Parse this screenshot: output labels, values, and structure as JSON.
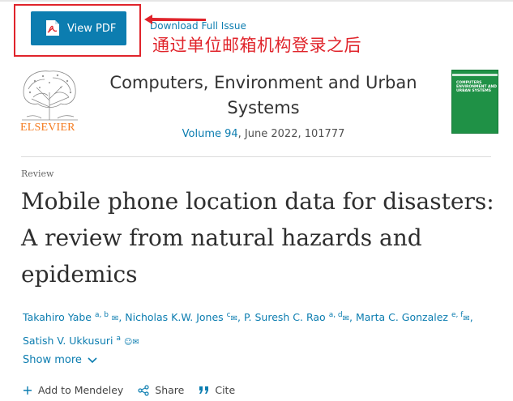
{
  "toolbar": {
    "view_pdf_label": "View PDF",
    "download_label": "Download Full Issue"
  },
  "annotation": {
    "note": "通过单位邮箱机构登录之后",
    "color": "#e0242b"
  },
  "journal": {
    "publisher": "ELSEVIER",
    "title": "Computers, Environment and Urban Systems",
    "volume_link": "Volume 94",
    "volume_rest": ", June 2022, 101777",
    "cover_text": "COMPUTERS ENVIRONMENT AND URBAN SYSTEMS"
  },
  "article": {
    "type": "Review",
    "title": "Mobile phone location data for disasters: A review from natural hazards and epidemics"
  },
  "authors": [
    {
      "name": "Takahiro Yabe",
      "sup": "a, b",
      "suffix": ", "
    },
    {
      "name": "Nicholas K.W. Jones",
      "sup": "c",
      "suffix": ", "
    },
    {
      "name": "P. Suresh C. Rao",
      "sup": "a, d",
      "suffix": ", "
    },
    {
      "name": "Marta C. Gonzalez",
      "sup": "e, f",
      "suffix": ","
    },
    {
      "name": "Satish V. Ukkusuri",
      "sup": "a",
      "suffix": ""
    }
  ],
  "show_more_label": "Show more",
  "actions": {
    "mendeley": "Add to Mendeley",
    "share": "Share",
    "cite": "Cite"
  },
  "colors": {
    "accent": "#0c7db0",
    "elsevier_orange": "#f47b20",
    "cover_green": "#1f9146"
  }
}
